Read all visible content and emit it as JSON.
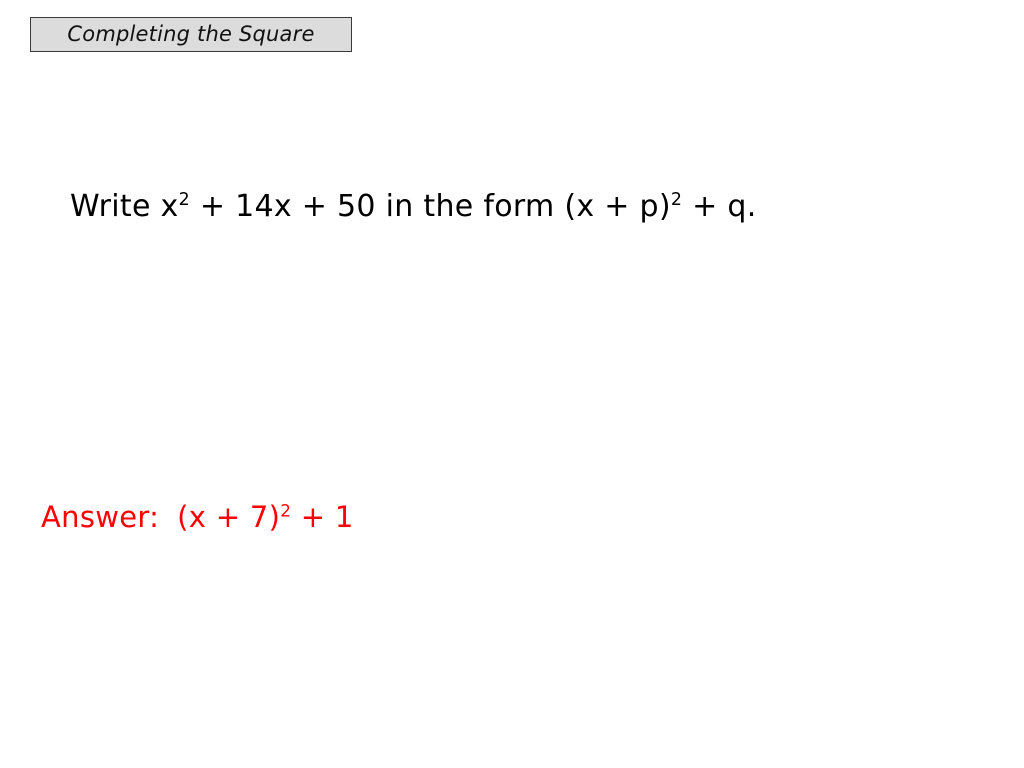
{
  "slide": {
    "background_color": "#ffffff",
    "title_badge": {
      "label": "Completing the Square",
      "fill_color": "#dcdcdc",
      "border_color": "#3a3a3a"
    },
    "question": {
      "prefix": "Write x",
      "exp1": "2",
      "mid": " + 14x + 50 in the form (x + p)",
      "exp2": "2",
      "suffix": " + q.",
      "full_text": "Write x2 + 14x + 50 in the form (x + p)2 + q.",
      "color": "#000000"
    },
    "answer": {
      "label": "Answer:",
      "expr_prefix": "(x + 7)",
      "expr_exp": "2",
      "expr_suffix": " + 1",
      "full_text": "Answer:  (x + 7)2 + 1",
      "color": "#ff0000"
    }
  }
}
